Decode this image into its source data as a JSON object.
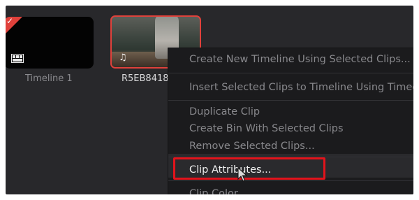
{
  "media_pool": {
    "items": [
      {
        "label": "Timeline 1",
        "icon": "timeline-icon",
        "selected": false
      },
      {
        "label": "R5EB8418",
        "icon": "music-note-icon",
        "selected": true
      }
    ]
  },
  "context_menu": {
    "items": [
      {
        "label": "Create New Timeline Using Selected Clips..."
      },
      {
        "label": "Insert Selected Clips to Timeline Using Timeco"
      },
      {
        "label": "Duplicate Clip"
      },
      {
        "label": "Create Bin With Selected Clips"
      },
      {
        "label": "Remove Selected Clips..."
      },
      {
        "label": "Clip Attributes...",
        "highlighted": true
      },
      {
        "label": "Clip Color"
      }
    ]
  },
  "colors": {
    "selection_border": "#e0413b",
    "callout": "#e3131b"
  }
}
